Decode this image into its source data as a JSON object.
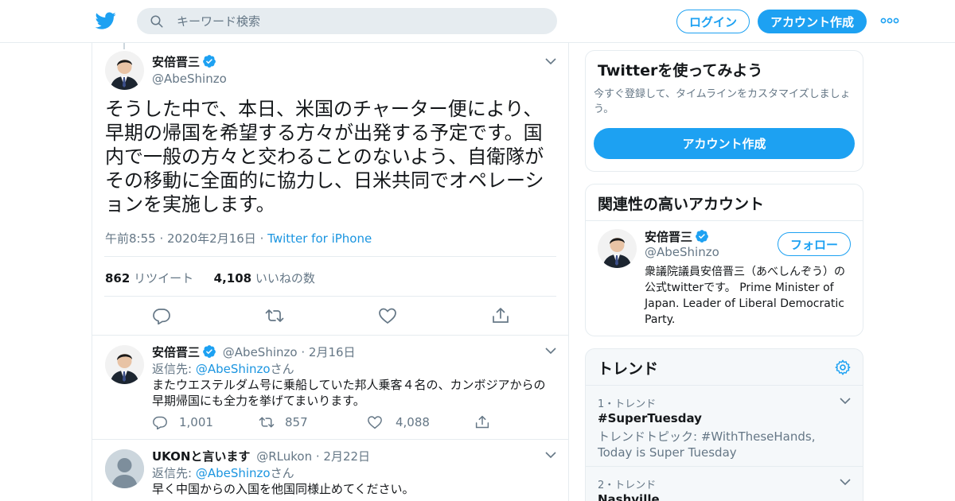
{
  "header": {
    "search_placeholder": "キーワード検索",
    "login_label": "ログイン",
    "signup_label": "アカウント作成"
  },
  "focus_tweet": {
    "display_name": "安倍晋三",
    "handle": "@AbeShinzo",
    "text": "そうした中で、本日、米国のチャーター便により、早期の帰国を希望する方々が出発する予定です。国内で一般の方々と交わることのないよう、自衛隊がその移動に全面的に協力し、日米共同でオペレーションを実施します。",
    "timestamp": "午前8:55 · 2020年2月16日",
    "separator": "·",
    "source": "Twitter for iPhone",
    "retweet_count": "862",
    "retweet_label": "リツイート",
    "like_count": "4,108",
    "like_label": "いいねの数"
  },
  "replies": [
    {
      "display_name": "安倍晋三",
      "handle": "@AbeShinzo",
      "date": "2月16日",
      "reply_prefix": "返信先: ",
      "reply_to": "@AbeShinzo",
      "reply_suffix": "さん",
      "text": "またウエステルダム号に乗船していた邦人乗客４名の、カンボジアからの早期帰国にも全力を挙げてまいります。",
      "reply_count": "1,001",
      "retweet_count": "857",
      "like_count": "4,088"
    },
    {
      "display_name": "UKONと言います",
      "handle": "@RLukon",
      "date": "2月22日",
      "reply_prefix": "返信先: ",
      "reply_to": "@AbeShinzo",
      "reply_suffix": "さん",
      "text": "早く中国からの入国を他国同様止めてください。"
    }
  ],
  "signup_card": {
    "title": "Twitterを使ってみよう",
    "description": "今すぐ登録して、タイムラインをカスタマイズしましょう。",
    "button_label": "アカウント作成"
  },
  "related_card": {
    "title": "関連性の高いアカウント",
    "display_name": "安倍晋三",
    "handle": "@AbeShinzo",
    "follow_label": "フォロー",
    "bio": "衆議院議員安倍晋三（あべしんぞう）の公式twitterです。 Prime Minister of Japan. Leader of Liberal Democratic Party."
  },
  "trends_card": {
    "title": "トレンド",
    "items": [
      {
        "meta": "1・トレンド",
        "name": "#SuperTuesday",
        "desc": "トレンドトピック: #WithTheseHands, Today is Super Tuesday"
      },
      {
        "meta": "2・トレンド",
        "name": "Nashville",
        "desc": ""
      }
    ]
  },
  "colors": {
    "accent": "#1da1f2",
    "link": "#1b95e0",
    "muted": "#657786",
    "border": "#e6ecf0"
  }
}
